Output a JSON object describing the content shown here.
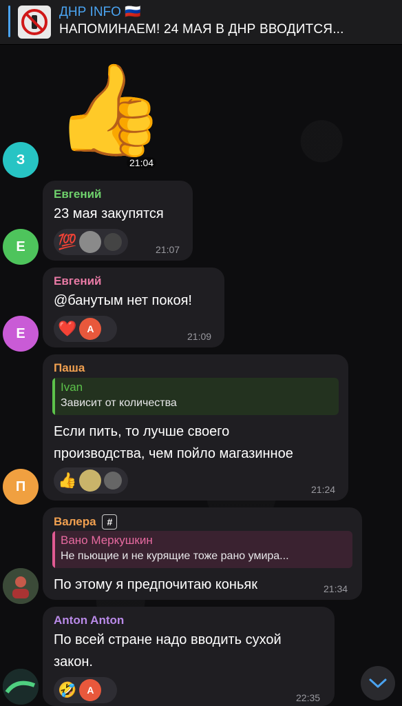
{
  "pinned": {
    "title": "ДНР INFO 🇷🇺",
    "text": "НАПОМИНАЕМ! 24 МАЯ В ДНР ВВОДИТСЯ..."
  },
  "messages": [
    {
      "avatar_letter": "З",
      "avatar_color": "#27c4c4",
      "sticker": "👍",
      "time": "21:04"
    },
    {
      "avatar_letter": "Е",
      "avatar_color": "#4ec45c",
      "sender": "Евгений",
      "sender_color": "#6fd16c",
      "text": "23 мая закупятся",
      "reactions": [
        "💯"
      ],
      "time": "21:07"
    },
    {
      "avatar_letter": "Е",
      "avatar_color": "#c95bd6",
      "sender": "Евгений",
      "sender_color": "#e87aa5",
      "text": "@банутым нет покоя!",
      "reactions": [
        "❤️"
      ],
      "reaction_avatar": "A",
      "time": "21:09"
    },
    {
      "avatar_letter": "П",
      "avatar_color": "#f0a040",
      "sender": "Паша",
      "sender_color": "#f0a050",
      "reply_name": "Ivan",
      "reply_text": "Зависит от количества",
      "text_line1": "Если пить, то лучше своего",
      "text_line2": "производства, чем пойло магазинное",
      "reactions": [
        "👍"
      ],
      "time": "21:24"
    },
    {
      "sender": "Валера",
      "sender_badge": "#",
      "sender_color": "#f0a050",
      "reply_name": "Вано Меркушкин",
      "reply_text": "Не пьющие и не курящие тоже рано умира...",
      "text": "По этому я предпочитаю коньяк",
      "time": "21:34"
    },
    {
      "sender": "Anton Anton",
      "sender_color": "#b98ae8",
      "text_line1": "По всей стране надо вводить сухой",
      "text_line2": "закон.",
      "reactions": [
        "🤣"
      ],
      "reaction_avatar": "A",
      "time": "22:35"
    }
  ],
  "colors": {
    "bubble": "#1f1e22",
    "time": "#9a9aa0",
    "accent": "#4aa3f0"
  }
}
